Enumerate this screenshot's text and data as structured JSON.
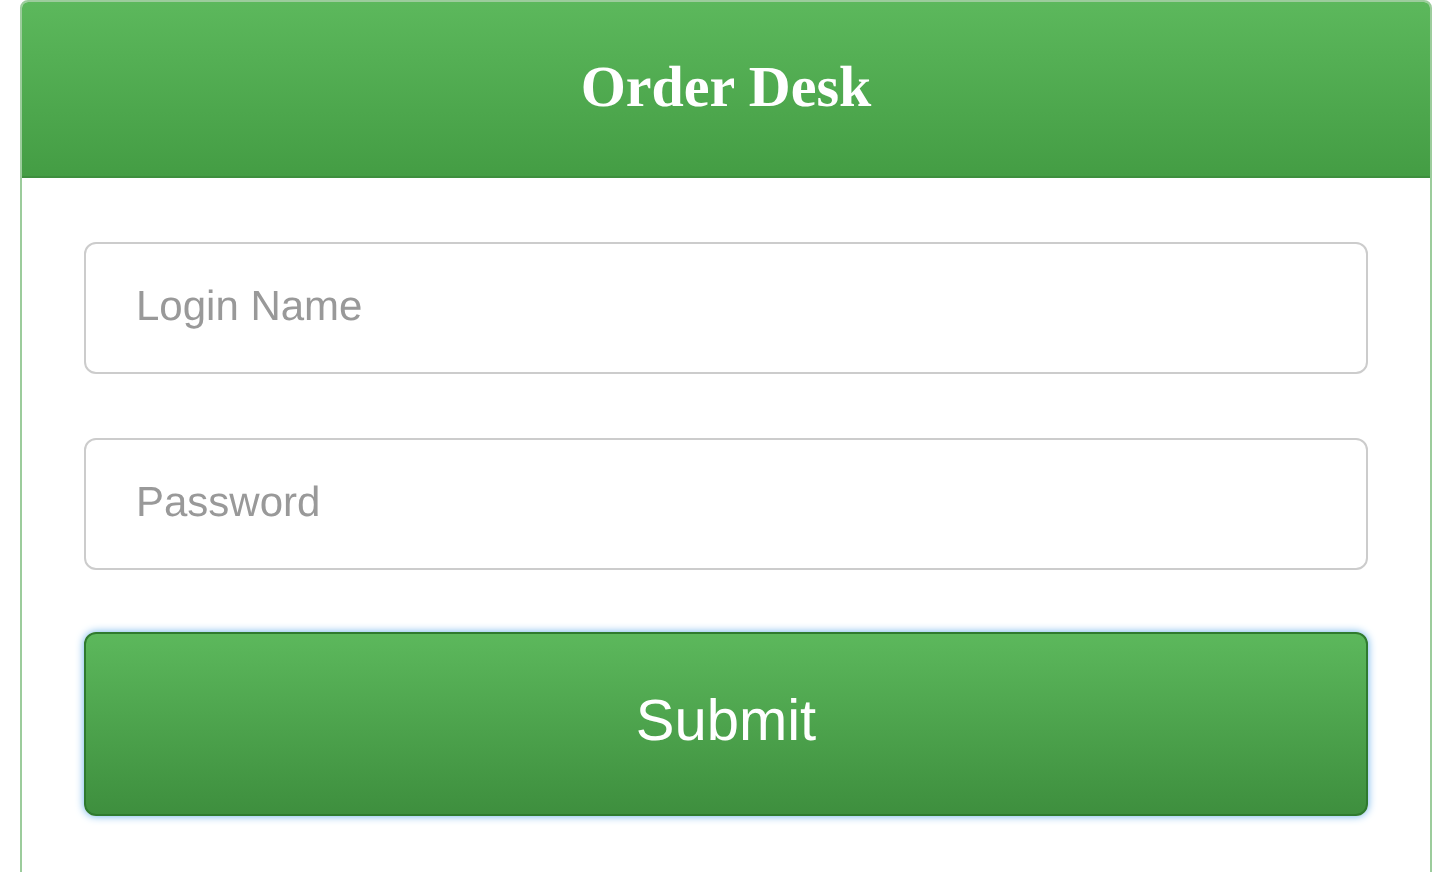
{
  "header": {
    "title": "Order Desk"
  },
  "fields": [
    {
      "placeholder": "Login Name"
    },
    {
      "placeholder": "Password"
    }
  ],
  "button": {
    "label": "Submit"
  }
}
